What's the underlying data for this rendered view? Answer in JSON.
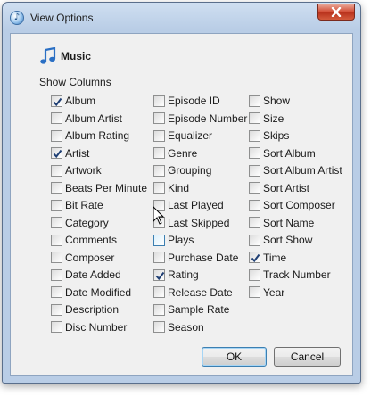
{
  "window": {
    "title": "View Options"
  },
  "heading": {
    "label": "Music",
    "icon": "music-note-icon"
  },
  "show_columns_label": "Show Columns",
  "columns": [
    [
      {
        "label": "Album",
        "checked": true
      },
      {
        "label": "Album Artist",
        "checked": false
      },
      {
        "label": "Album Rating",
        "checked": false
      },
      {
        "label": "Artist",
        "checked": true
      },
      {
        "label": "Artwork",
        "checked": false
      },
      {
        "label": "Beats Per Minute",
        "checked": false
      },
      {
        "label": "Bit Rate",
        "checked": false
      },
      {
        "label": "Category",
        "checked": false
      },
      {
        "label": "Comments",
        "checked": false
      },
      {
        "label": "Composer",
        "checked": false
      },
      {
        "label": "Date Added",
        "checked": false
      },
      {
        "label": "Date Modified",
        "checked": false
      },
      {
        "label": "Description",
        "checked": false
      },
      {
        "label": "Disc Number",
        "checked": false
      }
    ],
    [
      {
        "label": "Episode ID",
        "checked": false
      },
      {
        "label": "Episode Number",
        "checked": false
      },
      {
        "label": "Equalizer",
        "checked": false
      },
      {
        "label": "Genre",
        "checked": false
      },
      {
        "label": "Grouping",
        "checked": false
      },
      {
        "label": "Kind",
        "checked": false
      },
      {
        "label": "Last Played",
        "checked": false
      },
      {
        "label": "Last Skipped",
        "checked": false
      },
      {
        "label": "Plays",
        "checked": false,
        "hover": true
      },
      {
        "label": "Purchase Date",
        "checked": false
      },
      {
        "label": "Rating",
        "checked": true
      },
      {
        "label": "Release Date",
        "checked": false
      },
      {
        "label": "Sample Rate",
        "checked": false
      },
      {
        "label": "Season",
        "checked": false
      }
    ],
    [
      {
        "label": "Show",
        "checked": false
      },
      {
        "label": "Size",
        "checked": false
      },
      {
        "label": "Skips",
        "checked": false
      },
      {
        "label": "Sort Album",
        "checked": false
      },
      {
        "label": "Sort Album Artist",
        "checked": false
      },
      {
        "label": "Sort Artist",
        "checked": false
      },
      {
        "label": "Sort Composer",
        "checked": false
      },
      {
        "label": "Sort Name",
        "checked": false
      },
      {
        "label": "Sort Show",
        "checked": false
      },
      {
        "label": "Time",
        "checked": true
      },
      {
        "label": "Track Number",
        "checked": false
      },
      {
        "label": "Year",
        "checked": false
      }
    ]
  ],
  "buttons": {
    "ok": "OK",
    "cancel": "Cancel"
  },
  "colors": {
    "accent": "#3c7fb1",
    "close_button": "#c8402a",
    "check": "#1f3f74"
  }
}
